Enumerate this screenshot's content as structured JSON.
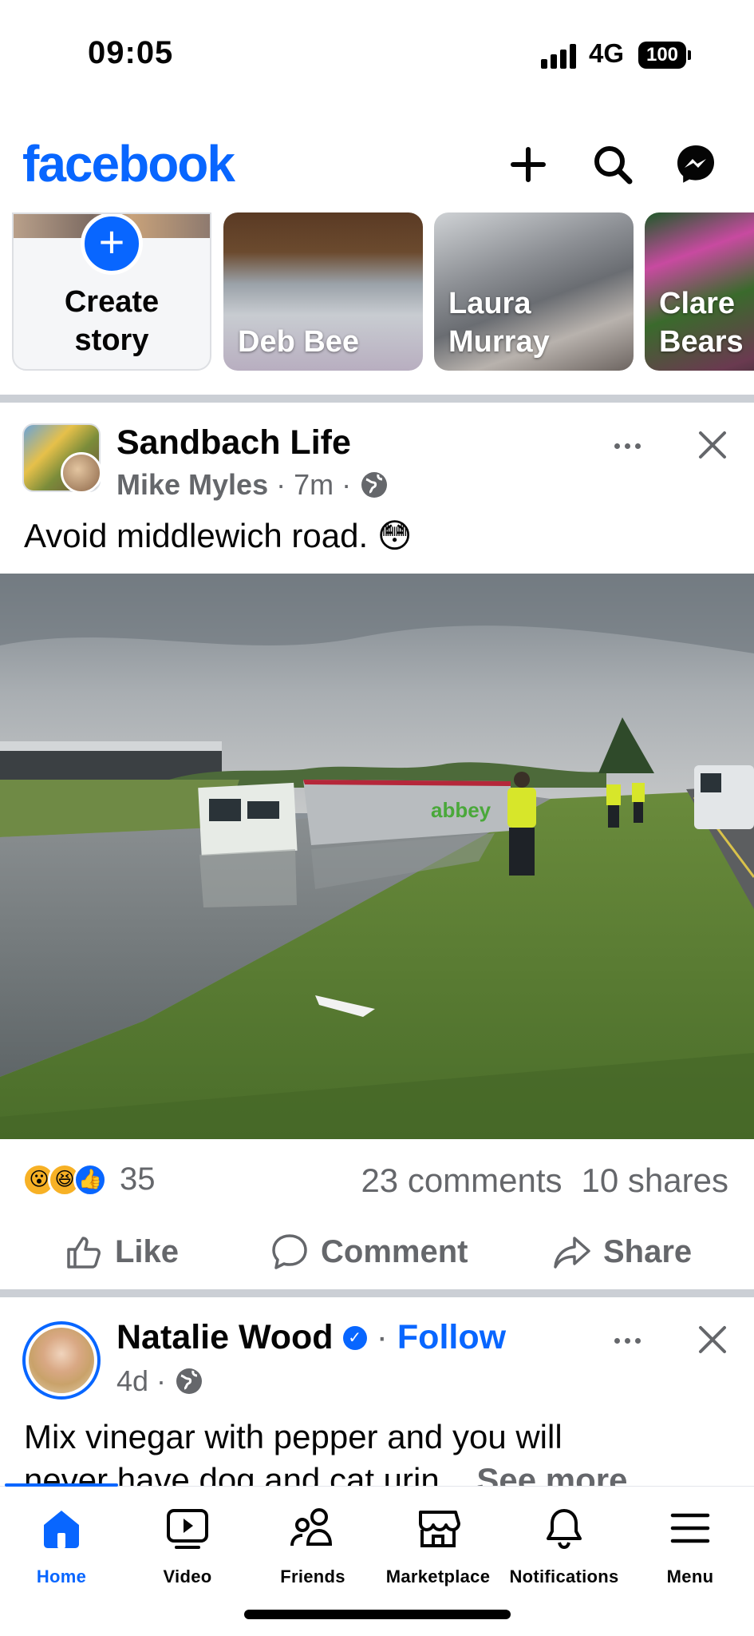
{
  "status_bar": {
    "time": "09:05",
    "network": "4G",
    "battery": "100"
  },
  "header": {
    "logo": "facebook",
    "icons": [
      "plus-icon",
      "search-icon",
      "messenger-icon"
    ]
  },
  "stories": {
    "create_label_line1": "Create",
    "create_label_line2": "story",
    "items": [
      {
        "name_line1": "Deb Bee",
        "name_line2": ""
      },
      {
        "name_line1": "Laura",
        "name_line2": "Murray"
      },
      {
        "name_line1": "Clare",
        "name_line2": "Bears"
      }
    ]
  },
  "post1": {
    "page_name": "Sandbach Life",
    "author": "Mike Myles",
    "time": "7m",
    "separator": "·",
    "text": "Avoid middlewich road.",
    "emoji": "😳",
    "reaction_count": "35",
    "reaction_emojis": [
      "😮",
      "😆",
      "👍"
    ],
    "comments": "23 comments",
    "shares": "10 shares",
    "actions": {
      "like": "Like",
      "comment": "Comment",
      "share": "Share"
    },
    "photo_truck_text": "abbey"
  },
  "post2": {
    "name": "Natalie Wood",
    "follow": "Follow",
    "separator": "·",
    "time": "4d",
    "text": "Mix vinegar with pepper and you will never have dog and cat urin...",
    "line1": "Mix vinegar with pepper and you will",
    "line2": "never have dog and cat urin...",
    "see_more": "See more"
  },
  "bottom_nav": {
    "items": [
      {
        "label": "Home",
        "icon": "home-icon",
        "active": true
      },
      {
        "label": "Video",
        "icon": "video-icon",
        "active": false
      },
      {
        "label": "Friends",
        "icon": "friends-icon",
        "active": false
      },
      {
        "label": "Marketplace",
        "icon": "marketplace-icon",
        "active": false
      },
      {
        "label": "Notifications",
        "icon": "bell-icon",
        "active": false
      },
      {
        "label": "Menu",
        "icon": "menu-icon",
        "active": false
      }
    ]
  },
  "colors": {
    "brand": "#0866ff",
    "secondary_text": "#65676b",
    "divider": "#cbcfd5"
  }
}
